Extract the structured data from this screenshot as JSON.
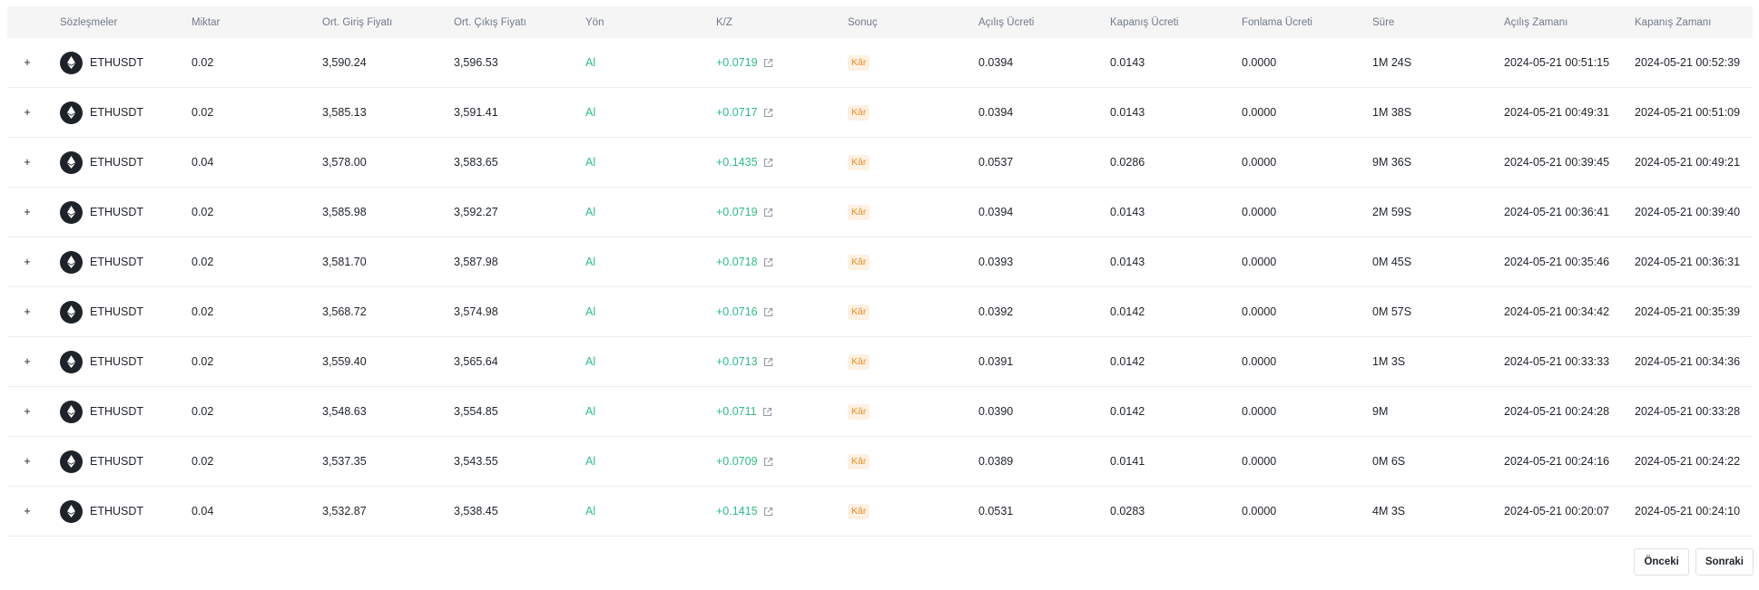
{
  "table": {
    "headers": [
      "Sözleşmeler",
      "Miktar",
      "Ort. Giriş Fiyatı",
      "Ort. Çıkış Fiyatı",
      "Yön",
      "K/Z",
      "Sonuç",
      "Açılış Ücreti",
      "Kapanış Ücreti",
      "Fonlama Ücreti",
      "Süre",
      "Açılış Zamanı",
      "Kapanış Zamanı"
    ],
    "expand_symbol": "+",
    "icons": {
      "expand": "plus-icon",
      "coin": "ethereum-icon",
      "pnl_link": "external-link-icon"
    },
    "colors": {
      "side": "#2ebd85",
      "pnl": "#2ebd85",
      "badge_text": "#ed8a1d",
      "badge_bg": "#fdf1e3",
      "coin_bg": "#1e2329"
    },
    "rows": [
      {
        "symbol": "ETHUSDT",
        "quantity": "0.02",
        "entry_price": "3,590.24",
        "exit_price": "3,596.53",
        "side": "Al",
        "pnl": "+0.0719",
        "result": "Kâr",
        "open_fee": "0.0394",
        "close_fee": "0.0143",
        "funding_fee": "0.0000",
        "duration": "1M 24S",
        "open_time": "2024-05-21 00:51:15",
        "close_time": "2024-05-21 00:52:39"
      },
      {
        "symbol": "ETHUSDT",
        "quantity": "0.02",
        "entry_price": "3,585.13",
        "exit_price": "3,591.41",
        "side": "Al",
        "pnl": "+0.0717",
        "result": "Kâr",
        "open_fee": "0.0394",
        "close_fee": "0.0143",
        "funding_fee": "0.0000",
        "duration": "1M 38S",
        "open_time": "2024-05-21 00:49:31",
        "close_time": "2024-05-21 00:51:09"
      },
      {
        "symbol": "ETHUSDT",
        "quantity": "0.04",
        "entry_price": "3,578.00",
        "exit_price": "3,583.65",
        "side": "Al",
        "pnl": "+0.1435",
        "result": "Kâr",
        "open_fee": "0.0537",
        "close_fee": "0.0286",
        "funding_fee": "0.0000",
        "duration": "9M 36S",
        "open_time": "2024-05-21 00:39:45",
        "close_time": "2024-05-21 00:49:21"
      },
      {
        "symbol": "ETHUSDT",
        "quantity": "0.02",
        "entry_price": "3,585.98",
        "exit_price": "3,592.27",
        "side": "Al",
        "pnl": "+0.0719",
        "result": "Kâr",
        "open_fee": "0.0394",
        "close_fee": "0.0143",
        "funding_fee": "0.0000",
        "duration": "2M 59S",
        "open_time": "2024-05-21 00:36:41",
        "close_time": "2024-05-21 00:39:40"
      },
      {
        "symbol": "ETHUSDT",
        "quantity": "0.02",
        "entry_price": "3,581.70",
        "exit_price": "3,587.98",
        "side": "Al",
        "pnl": "+0.0718",
        "result": "Kâr",
        "open_fee": "0.0393",
        "close_fee": "0.0143",
        "funding_fee": "0.0000",
        "duration": "0M 45S",
        "open_time": "2024-05-21 00:35:46",
        "close_time": "2024-05-21 00:36:31"
      },
      {
        "symbol": "ETHUSDT",
        "quantity": "0.02",
        "entry_price": "3,568.72",
        "exit_price": "3,574.98",
        "side": "Al",
        "pnl": "+0.0716",
        "result": "Kâr",
        "open_fee": "0.0392",
        "close_fee": "0.0142",
        "funding_fee": "0.0000",
        "duration": "0M 57S",
        "open_time": "2024-05-21 00:34:42",
        "close_time": "2024-05-21 00:35:39"
      },
      {
        "symbol": "ETHUSDT",
        "quantity": "0.02",
        "entry_price": "3,559.40",
        "exit_price": "3,565.64",
        "side": "Al",
        "pnl": "+0.0713",
        "result": "Kâr",
        "open_fee": "0.0391",
        "close_fee": "0.0142",
        "funding_fee": "0.0000",
        "duration": "1M 3S",
        "open_time": "2024-05-21 00:33:33",
        "close_time": "2024-05-21 00:34:36"
      },
      {
        "symbol": "ETHUSDT",
        "quantity": "0.02",
        "entry_price": "3,548.63",
        "exit_price": "3,554.85",
        "side": "Al",
        "pnl": "+0.0711",
        "result": "Kâr",
        "open_fee": "0.0390",
        "close_fee": "0.0142",
        "funding_fee": "0.0000",
        "duration": "9M",
        "open_time": "2024-05-21 00:24:28",
        "close_time": "2024-05-21 00:33:28"
      },
      {
        "symbol": "ETHUSDT",
        "quantity": "0.02",
        "entry_price": "3,537.35",
        "exit_price": "3,543.55",
        "side": "Al",
        "pnl": "+0.0709",
        "result": "Kâr",
        "open_fee": "0.0389",
        "close_fee": "0.0141",
        "funding_fee": "0.0000",
        "duration": "0M 6S",
        "open_time": "2024-05-21 00:24:16",
        "close_time": "2024-05-21 00:24:22"
      },
      {
        "symbol": "ETHUSDT",
        "quantity": "0.04",
        "entry_price": "3,532.87",
        "exit_price": "3,538.45",
        "side": "Al",
        "pnl": "+0.1415",
        "result": "Kâr",
        "open_fee": "0.0531",
        "close_fee": "0.0283",
        "funding_fee": "0.0000",
        "duration": "4M 3S",
        "open_time": "2024-05-21 00:20:07",
        "close_time": "2024-05-21 00:24:10"
      }
    ]
  },
  "pagination": {
    "prev_label": "Önceki",
    "next_label": "Sonraki"
  }
}
